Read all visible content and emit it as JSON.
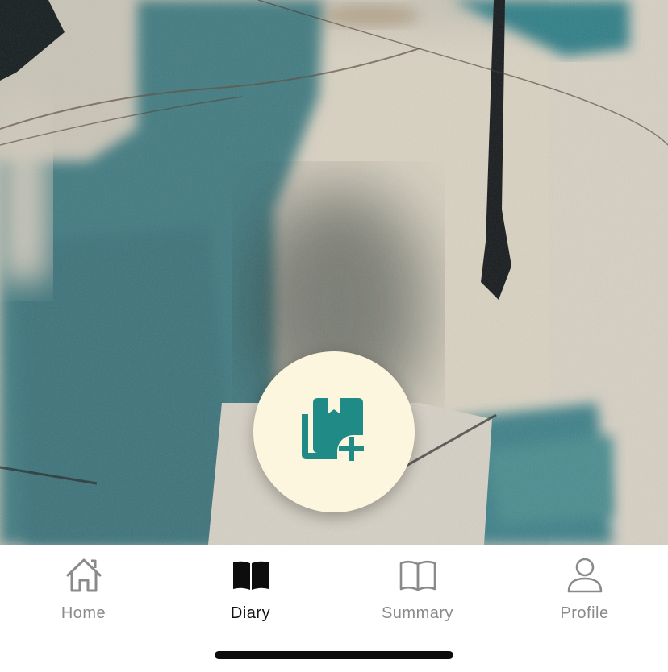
{
  "colors": {
    "fab_background": "#fdf6df",
    "fab_icon": "#1f8a86",
    "tab_active": "#111111",
    "tab_inactive": "#8a8a8a"
  },
  "fab": {
    "icon": "add-book-icon"
  },
  "tab_bar": {
    "tabs": [
      {
        "label": "Home",
        "icon": "home-icon",
        "active": false
      },
      {
        "label": "Diary",
        "icon": "open-book-icon",
        "active": true
      },
      {
        "label": "Summary",
        "icon": "book-outline-icon",
        "active": false
      },
      {
        "label": "Profile",
        "icon": "person-icon",
        "active": false
      }
    ]
  }
}
